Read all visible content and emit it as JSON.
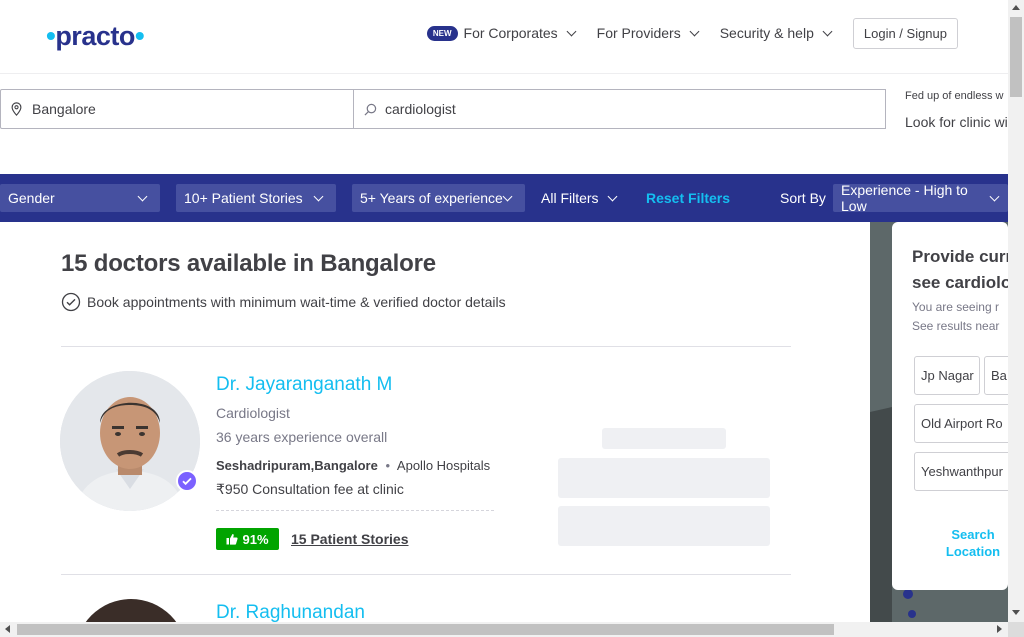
{
  "header": {
    "logo": "practo",
    "nav": {
      "new_badge": "NEW",
      "corporates": "For Corporates",
      "providers": "For Providers",
      "security": "Security & help",
      "login": "Login / Signup"
    }
  },
  "search": {
    "location": "Bangalore",
    "query": "cardiologist",
    "promo_line1": "Fed up of endless w",
    "promo_line2": "Look for clinic wi"
  },
  "filters": {
    "gender": "Gender",
    "stories": "10+ Patient Stories",
    "experience": "5+ Years of experience",
    "all": "All Filters",
    "reset": "Reset Filters",
    "sort_label": "Sort By",
    "sort_value": "Experience - High to Low"
  },
  "results": {
    "title": "15 doctors available in Bangalore",
    "subtitle": "Book appointments with minimum wait-time & verified doctor details"
  },
  "doctors": [
    {
      "name": "Dr. Jayaranganath M",
      "specialty": "Cardiologist",
      "experience": "36 years experience overall",
      "locality": "Seshadripuram,Bangalore",
      "separator": "•",
      "clinic": "Apollo Hospitals",
      "fee": "₹950 Consultation fee at clinic",
      "rating": "91%",
      "stories": "15 Patient Stories"
    },
    {
      "name": "Dr. Raghunandan"
    }
  ],
  "sidebar": {
    "title_line1": "Provide curr",
    "title_line2": "see cardiolo",
    "sub_line1": "You are seeing r",
    "sub_line2": "See results near",
    "locations": [
      "Jp Nagar",
      "Ba",
      "Old Airport Ro",
      "Yeshwanthpur"
    ],
    "link_line1": "Search",
    "link_line2": "Location"
  },
  "colors": {
    "brand_navy": "#28328c",
    "brand_blue": "#14bef0",
    "rating_green": "#01a400"
  }
}
